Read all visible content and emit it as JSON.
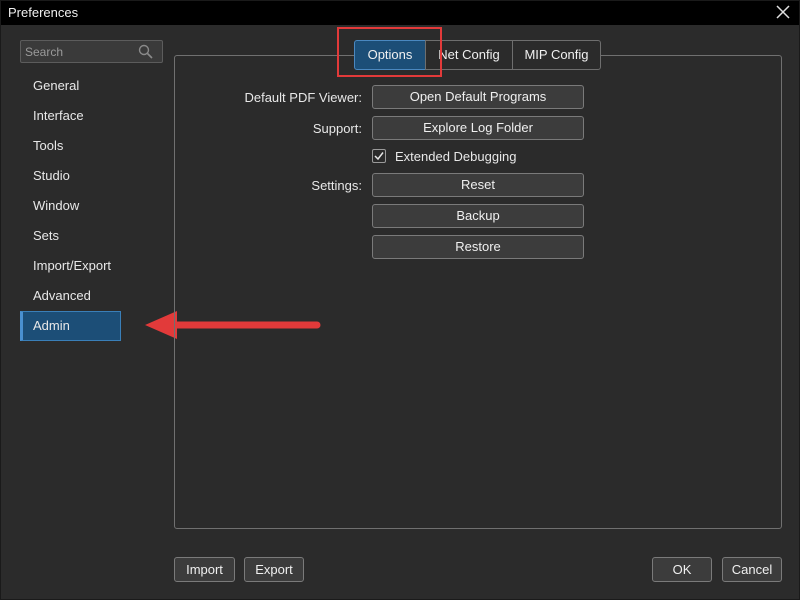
{
  "window": {
    "title": "Preferences"
  },
  "search": {
    "placeholder": "Search"
  },
  "sidebar": {
    "items": [
      {
        "label": "General"
      },
      {
        "label": "Interface"
      },
      {
        "label": "Tools"
      },
      {
        "label": "Studio"
      },
      {
        "label": "Window"
      },
      {
        "label": "Sets"
      },
      {
        "label": "Import/Export"
      },
      {
        "label": "Advanced"
      },
      {
        "label": "Admin",
        "active": true
      }
    ]
  },
  "tabs": [
    {
      "label": "Options",
      "active": true
    },
    {
      "label": "Net Config"
    },
    {
      "label": "MIP Config"
    }
  ],
  "options": {
    "pdf_viewer_label": "Default PDF Viewer:",
    "pdf_viewer_button": "Open Default Programs",
    "support_label": "Support:",
    "support_button": "Explore Log Folder",
    "debug_checkbox_label": "Extended Debugging",
    "debug_checked": true,
    "settings_label": "Settings:",
    "reset_button": "Reset",
    "backup_button": "Backup",
    "restore_button": "Restore"
  },
  "footer": {
    "import_label": "Import",
    "export_label": "Export",
    "ok_label": "OK",
    "cancel_label": "Cancel"
  },
  "colors": {
    "accent": "#1c4e77",
    "annotation": "#e23a3a",
    "background": "#2b2b2b"
  }
}
